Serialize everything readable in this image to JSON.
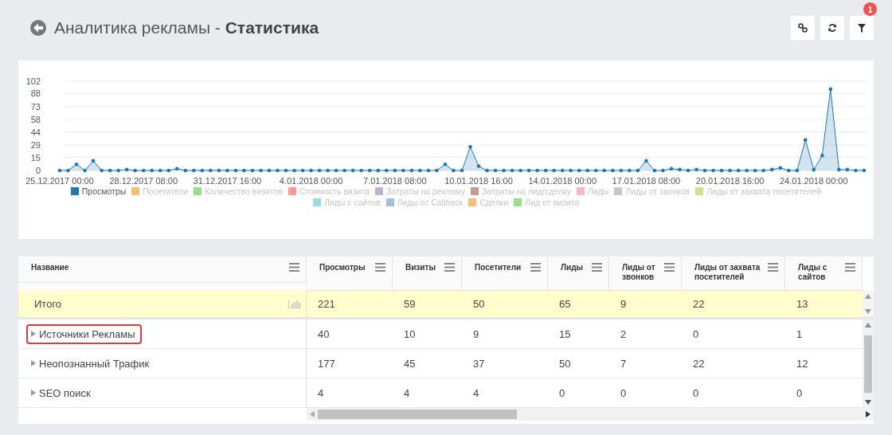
{
  "header": {
    "title": "Аналитика рекламы - **Статистика**",
    "buttons": [
      {
        "kind": "link"
      },
      {
        "kind": "refresh"
      },
      {
        "kind": "filter",
        "badge": "1"
      }
    ]
  },
  "chart": {
    "chart_data": {
      "type": "area",
      "categories": [
        "25.12.2017 00:00",
        null,
        null,
        null,
        null,
        null,
        null,
        null,
        null,
        null,
        "28.12.2017 08:00",
        null,
        null,
        null,
        null,
        null,
        null,
        null,
        null,
        null,
        "31.12.2017 16:00",
        null,
        null,
        null,
        null,
        null,
        null,
        null,
        null,
        null,
        "4.01.2018 00:00",
        null,
        null,
        null,
        null,
        null,
        null,
        null,
        null,
        null,
        "7.01.2018 08:00",
        null,
        null,
        null,
        null,
        null,
        null,
        null,
        null,
        null,
        "10.01.2018 16:00",
        null,
        null,
        null,
        null,
        null,
        null,
        null,
        null,
        null,
        "14.01.2018 00:00",
        null,
        null,
        null,
        null,
        null,
        null,
        null,
        null,
        null,
        "17.01.2018 08:00",
        null,
        null,
        null,
        null,
        null,
        null,
        null,
        null,
        null,
        "20.01.2018 16:00",
        null,
        null,
        null,
        null,
        null,
        null,
        null,
        null,
        null,
        "24.01.2018 00:00",
        null,
        null,
        null,
        null,
        null,
        null
      ],
      "series": [
        {
          "name": "Просмотры",
          "color": "#1f77b4",
          "values": [
            0,
            0,
            7,
            0,
            11,
            0,
            0,
            0,
            1,
            0,
            0,
            0,
            0,
            0,
            2,
            0,
            0,
            0,
            0,
            0,
            0,
            0,
            0,
            0,
            0,
            0,
            0,
            0,
            0,
            0,
            0,
            0,
            0,
            0,
            0,
            0,
            0,
            0,
            0,
            0,
            0,
            0,
            0,
            0,
            0,
            0,
            7,
            0,
            0,
            27,
            5,
            0,
            0,
            0,
            0,
            0,
            0,
            0,
            0,
            0,
            0,
            0,
            0,
            0,
            0,
            0,
            0,
            0,
            0,
            0,
            11,
            0,
            0,
            2,
            1,
            0,
            1,
            0,
            0,
            0,
            0,
            0,
            0,
            0,
            0,
            1,
            3,
            0,
            0,
            35,
            1,
            17,
            93,
            1,
            1,
            0,
            0
          ]
        }
      ],
      "yticks": [
        0,
        15,
        29,
        44,
        58,
        73,
        88,
        102
      ],
      "ylim": [
        0,
        102
      ],
      "grid": true
    },
    "legend": [
      {
        "label": "Посетители",
        "color": "#ffbb78",
        "visible": false
      },
      {
        "label": "Количество визитов",
        "color": "#98df8a",
        "visible": false
      },
      {
        "label": "Стоимость визита",
        "color": "#ff9896",
        "visible": false
      },
      {
        "label": "Затраты на рекламу",
        "color": "#c5b0d5",
        "visible": false
      },
      {
        "label": "Затраты на лид/сделку",
        "color": "#c49c94",
        "visible": false
      },
      {
        "label": "Лиды",
        "color": "#f7b6d2",
        "visible": false
      },
      {
        "label": "Лиды от звонков",
        "color": "#c7c7c7",
        "visible": false
      },
      {
        "label": "Лиды от захвата посетителей",
        "color": "#dbdb8d",
        "visible": false
      },
      {
        "label": "Лиды с сайтов",
        "color": "#9edae5",
        "visible": false
      },
      {
        "label": "Лиды от Callback",
        "color": "#9ebfdf",
        "visible": false
      },
      {
        "label": "Сделки",
        "color": "#ffbb78",
        "visible": false
      },
      {
        "label": "Лид от визита",
        "color": "#98df8a",
        "visible": false
      }
    ]
  },
  "table": {
    "columns": [
      "Название",
      "Просмотры",
      "Визиты",
      "Посетители",
      "Лиды",
      "Лиды от звонков",
      "Лиды от захвата посетителей",
      "Лиды с сайтов"
    ],
    "total": {
      "cells": [
        "Итого",
        "221",
        "59",
        "50",
        "65",
        "9",
        "22",
        "13"
      ]
    },
    "rows": [
      {
        "outlined": true,
        "cells": [
          "Источники Рекламы",
          "40",
          "10",
          "9",
          "15",
          "2",
          "0",
          "1"
        ]
      },
      {
        "outlined": false,
        "cells": [
          "Неопознанный Трафик",
          "177",
          "45",
          "37",
          "50",
          "7",
          "22",
          "12"
        ]
      },
      {
        "outlined": false,
        "cells": [
          "SEO поиск",
          "4",
          "4",
          "4",
          "0",
          "0",
          "0",
          "0"
        ]
      }
    ]
  }
}
